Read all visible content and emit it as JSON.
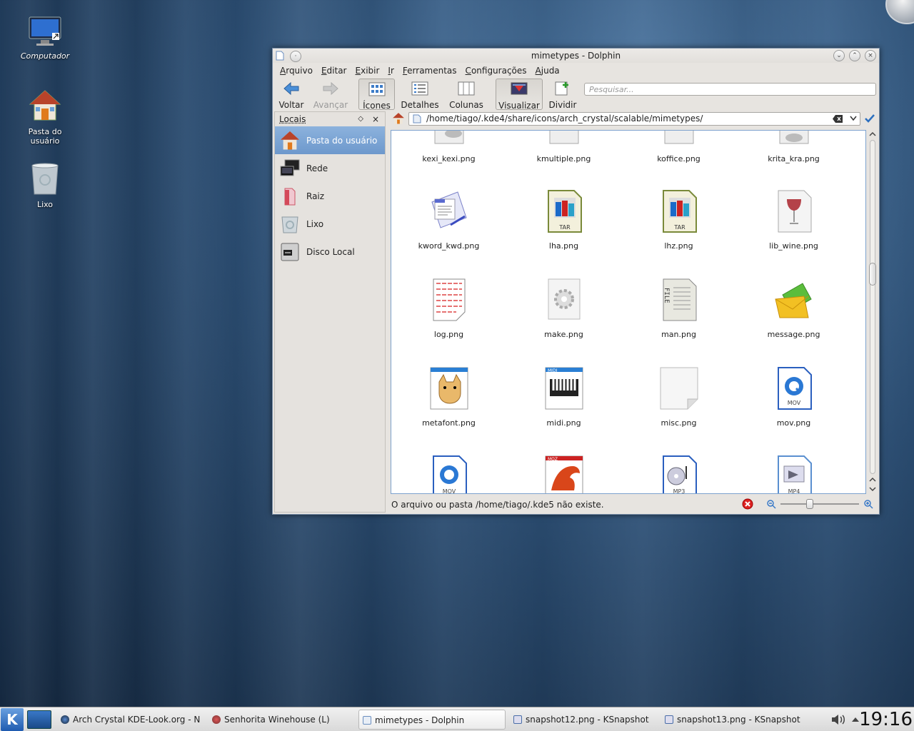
{
  "desktop": {
    "icons": [
      {
        "label": "Computador"
      },
      {
        "label": "Pasta do usuário"
      },
      {
        "label": "Lixo"
      }
    ]
  },
  "window": {
    "title": "mimetypes - Dolphin",
    "menu": [
      "Arquivo",
      "Editar",
      "Exibir",
      "Ir",
      "Ferramentas",
      "Configurações",
      "Ajuda"
    ],
    "toolbar": {
      "back": "Voltar",
      "forward": "Avançar",
      "icons": "Ícones",
      "details": "Detalhes",
      "columns": "Colunas",
      "preview": "Visualizar",
      "split": "Dividir",
      "search_placeholder": "Pesquisar..."
    },
    "places": {
      "title": "Locais",
      "items": [
        {
          "label": "Pasta do usuário"
        },
        {
          "label": "Rede"
        },
        {
          "label": "Raiz"
        },
        {
          "label": "Lixo"
        },
        {
          "label": "Disco Local"
        }
      ]
    },
    "path": "/home/tiago/.kde4/share/icons/arch_crystal/scalable/mimetypes/",
    "files": [
      "kexi_kexi.png",
      "kmultiple.png",
      "koffice.png",
      "krita_kra.png",
      "kword_kwd.png",
      "lha.png",
      "lhz.png",
      "lib_wine.png",
      "log.png",
      "make.png",
      "man.png",
      "message.png",
      "metafont.png",
      "midi.png",
      "misc.png",
      "mov.png"
    ],
    "partial_labels": {
      "tar1": "TAR",
      "tar2": "TAR",
      "mov1": "MOV",
      "midi": "MIDI",
      "moz": "MOZ",
      "mov2": "MOV",
      "mp3": "MP3",
      "mp4": "MP4"
    },
    "status": "O arquivo ou pasta /home/tiago/.kde5 não existe."
  },
  "taskbar": {
    "tasks": [
      "Arch Crystal KDE-Look.org - Na",
      "Senhorita Winehouse  (L)",
      "mimetypes - Dolphin",
      "snapshot12.png - KSnapshot",
      "snapshot13.png - KSnapshot"
    ],
    "clock": "19:16"
  }
}
